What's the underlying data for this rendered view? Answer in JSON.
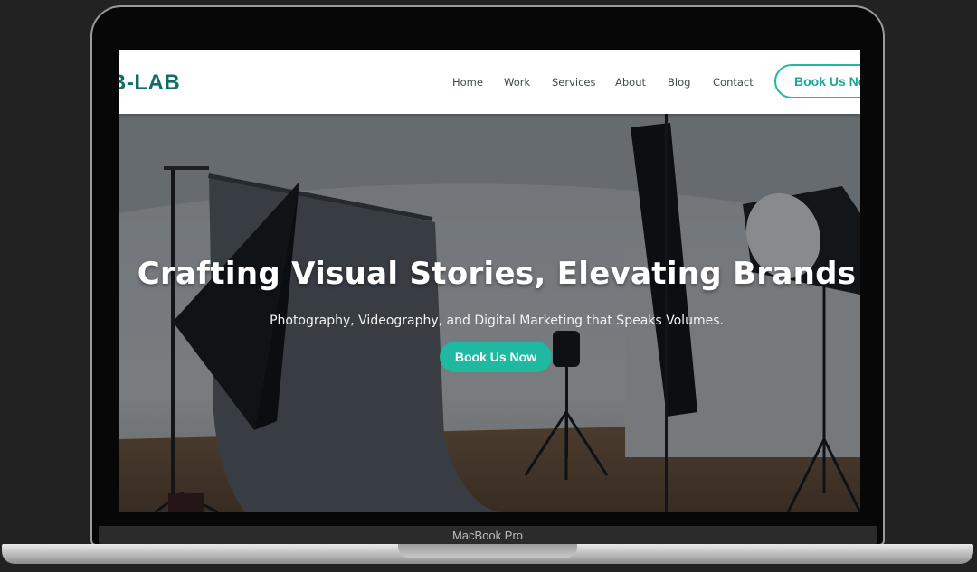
{
  "device": {
    "label": "MacBook Pro"
  },
  "site": {
    "logo": "B-LAB",
    "nav": {
      "items": [
        {
          "label": "Home"
        },
        {
          "label": "Work"
        },
        {
          "label": "Services"
        },
        {
          "label": "About"
        },
        {
          "label": "Blog"
        },
        {
          "label": "Contact"
        }
      ],
      "cta_label": "Book Us Now"
    },
    "hero": {
      "title": "Crafting Visual Stories, Elevating Brands",
      "subtitle": "Photography, Videography, and Digital Marketing that Speaks Volumes.",
      "cta_label": "Book Us Now",
      "background_icon": "photo-studio-image"
    }
  },
  "colors": {
    "accent": "#1fb8a1",
    "logo": "#0f6f66",
    "nav_text": "#3d4b4b",
    "page_background": "#222222"
  }
}
